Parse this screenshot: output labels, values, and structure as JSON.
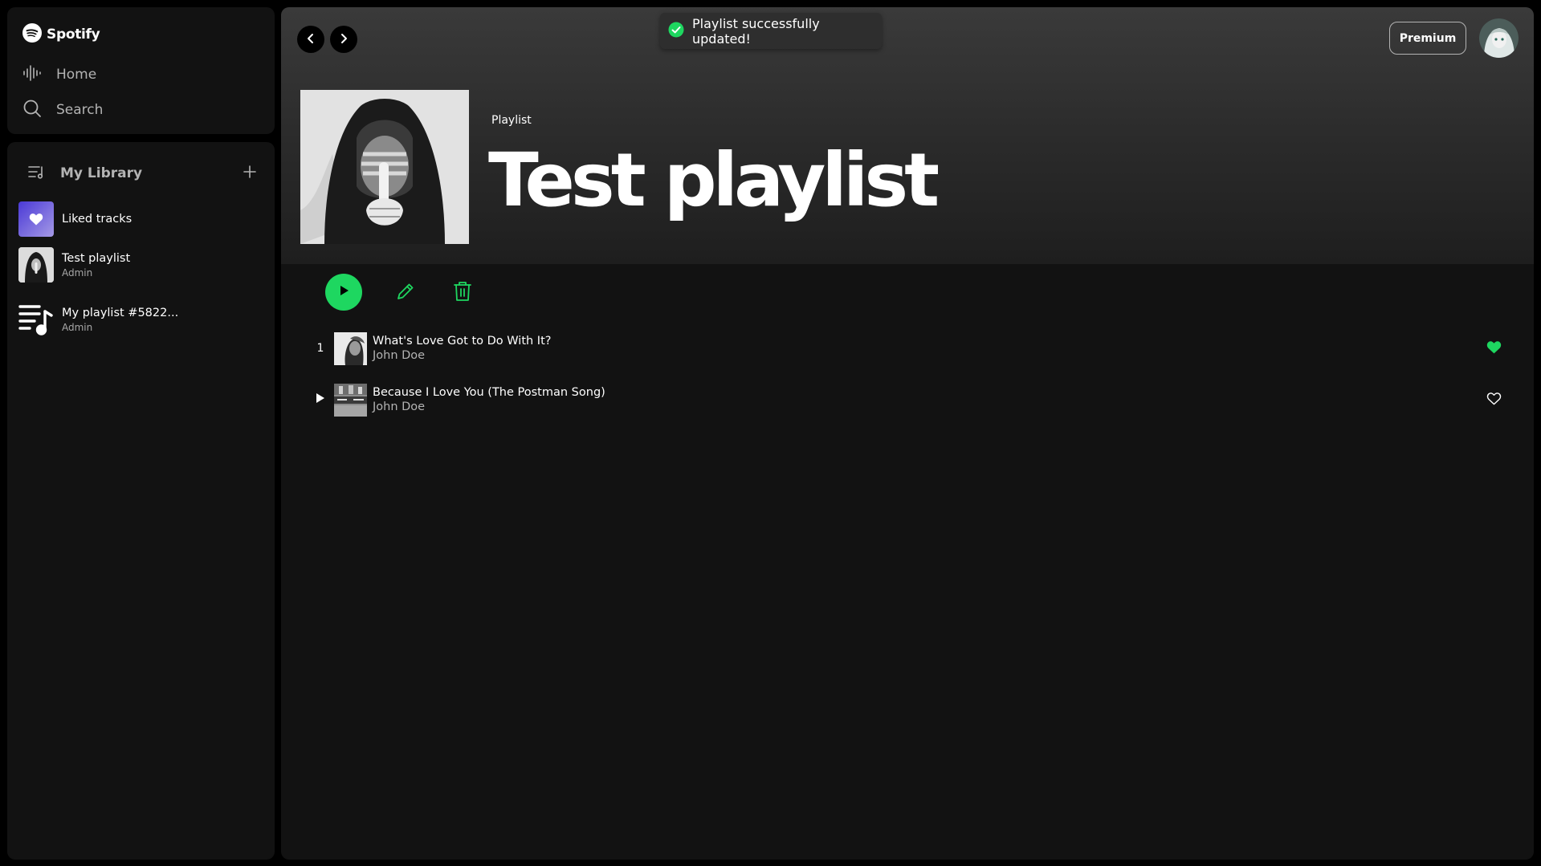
{
  "app": {
    "brand": "Spotify",
    "accent": "#1ed760"
  },
  "nav": {
    "home_label": "Home",
    "search_label": "Search"
  },
  "library": {
    "title": "My Library",
    "items": [
      {
        "name": "Liked tracks",
        "subtitle": ""
      },
      {
        "name": "Test playlist",
        "subtitle": "Admin"
      },
      {
        "name": "My playlist #5822...",
        "subtitle": "Admin"
      }
    ]
  },
  "toast": {
    "message": "Playlist successfully updated!",
    "status_color": "#1ed760"
  },
  "header": {
    "premium_label": "Premium"
  },
  "playlist": {
    "type_label": "Playlist",
    "title": "Test playlist"
  },
  "tracks": [
    {
      "index": "1",
      "title": "What's Love Got to Do With It?",
      "artist": "John Doe",
      "liked": true
    },
    {
      "index": "",
      "title": "Because I Love You (The Postman Song)",
      "artist": "John Doe",
      "liked": false
    }
  ]
}
